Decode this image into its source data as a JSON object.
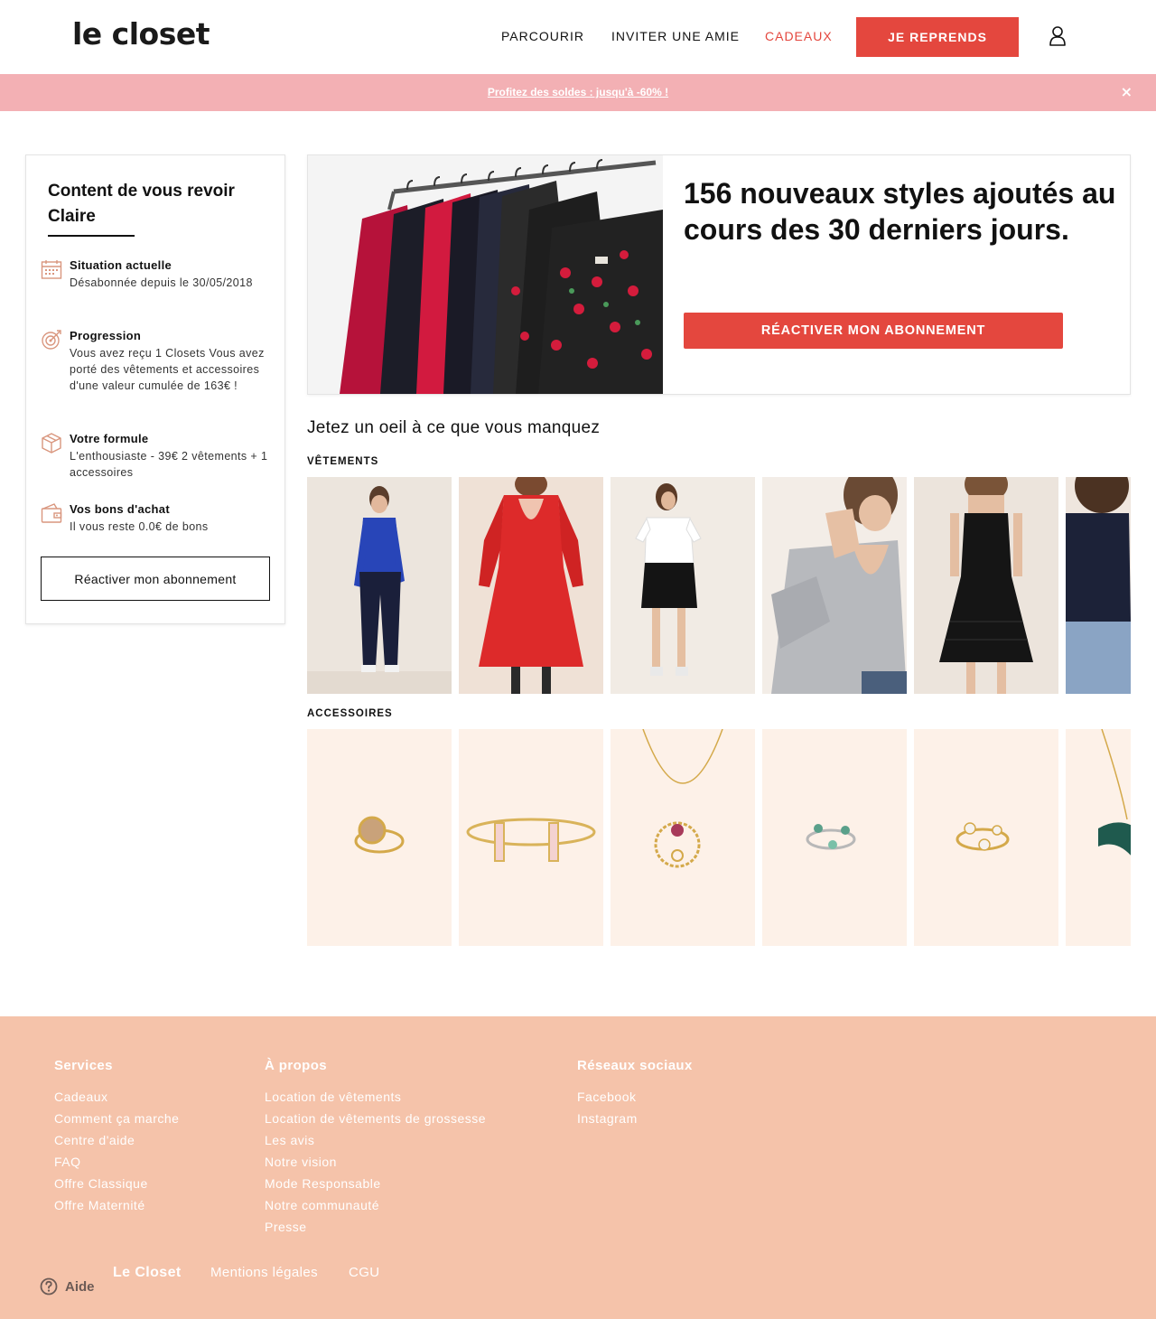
{
  "header": {
    "logo": "le closet",
    "nav": [
      "PARCOURIR",
      "INVITER UNE AMIE",
      "CADEAUX"
    ],
    "cta": "JE REPRENDS"
  },
  "promo": {
    "text": "Profitez des soldes : jusqu'à -60% !",
    "close": "×"
  },
  "sidebar": {
    "welcome": "Content de vous revoir Claire",
    "items": [
      {
        "icon": "calendar-icon",
        "title": "Situation actuelle",
        "text": "Désabonnée depuis le 30/05/2018"
      },
      {
        "icon": "target-icon",
        "title": "Progression",
        "text": "Vous avez reçu 1 Closets Vous avez porté des vêtements et accessoires d'une valeur cumulée de 163€ !"
      },
      {
        "icon": "box-icon",
        "title": "Votre formule",
        "text": "L'enthousiaste - 39€ 2 vêtements + 1 accessoires"
      },
      {
        "icon": "wallet-icon",
        "title": "Vos bons d'achat",
        "text": "Il vous reste 0.0€ de bons"
      }
    ],
    "button": "Réactiver mon abonnement"
  },
  "hero": {
    "title": "156 nouveaux styles ajoutés au cours des 30 derniers jours.",
    "button": "RÉACTIVER MON ABONNEMENT"
  },
  "missing": {
    "title": "Jetez un oeil à ce que vous manquez",
    "clothes_label": "VÊTEMENTS",
    "accessories_label": "ACCESSOIRES"
  },
  "footer": {
    "services": {
      "heading": "Services",
      "links": [
        "Cadeaux",
        "Comment ça marche",
        "Centre d'aide",
        "FAQ",
        "Offre Classique",
        "Offre Maternité"
      ]
    },
    "about": {
      "heading": "À propos",
      "links": [
        "Location de vêtements",
        "Location de vêtements de grossesse",
        "Les avis",
        "Notre vision",
        "Mode Responsable",
        "Notre communauté",
        "Presse"
      ]
    },
    "social": {
      "heading": "Réseaux sociaux",
      "links": [
        "Facebook",
        "Instagram"
      ]
    },
    "bottom": [
      "Le Closet",
      "Mentions légales",
      "CGU"
    ],
    "help": "Aide"
  },
  "colors": {
    "accent": "#e4473e",
    "promo_bg": "#f3b0b4",
    "footer_bg": "#f5c3aa"
  }
}
